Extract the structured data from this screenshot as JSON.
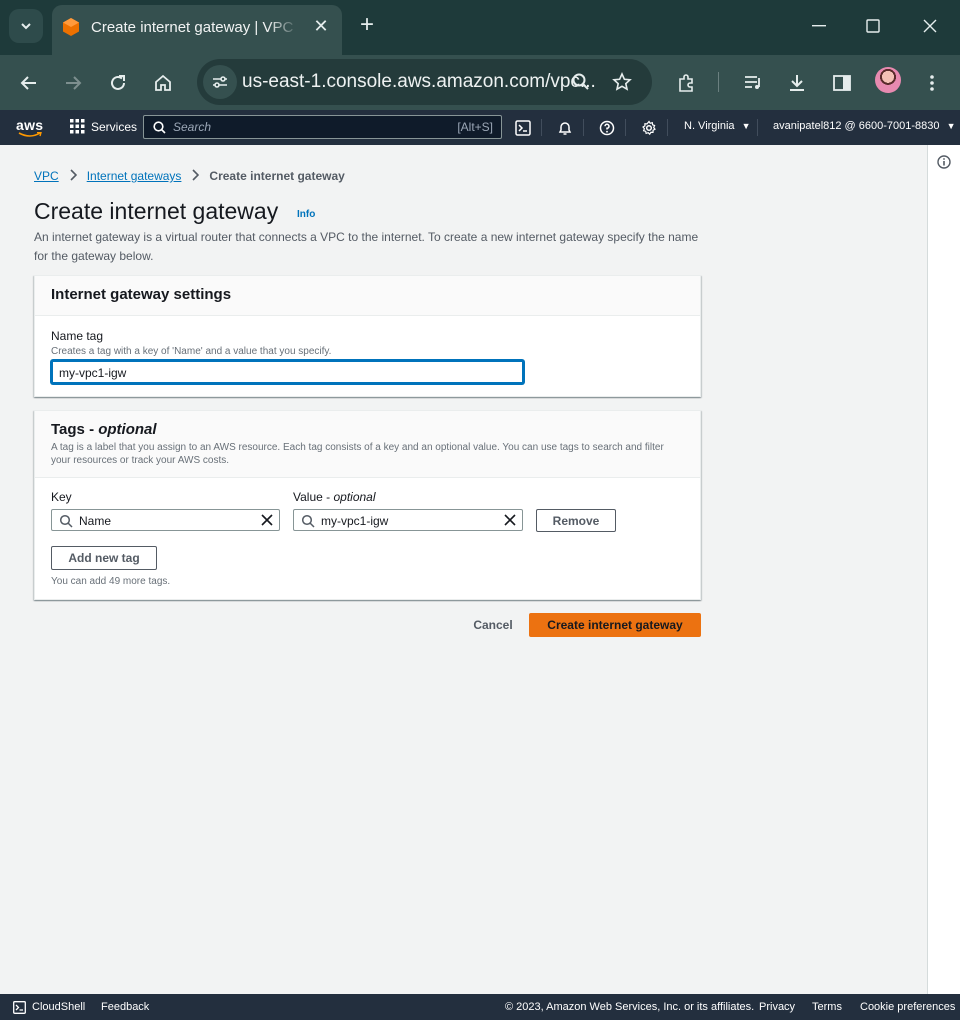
{
  "browser": {
    "tab_title": "Create internet gateway | VPC Management Console",
    "url": "us-east-1.console.aws.amazon.com/vpc..."
  },
  "aws_nav": {
    "logo": "aws",
    "services_label": "Services",
    "search_placeholder": "Search",
    "search_shortcut": "[Alt+S]",
    "region": "N. Virginia",
    "account": "avanipatel812 @ 6600-7001-8830"
  },
  "breadcrumb": {
    "items": [
      "VPC",
      "Internet gateways"
    ],
    "current": "Create internet gateway"
  },
  "page": {
    "title": "Create internet gateway",
    "info_label": "Info",
    "description": "An internet gateway is a virtual router that connects a VPC to the internet. To create a new internet gateway specify the name for the gateway below."
  },
  "settings_panel": {
    "title": "Internet gateway settings",
    "name_tag_label": "Name tag",
    "name_tag_hint": "Creates a tag with a key of 'Name' and a value that you specify.",
    "name_tag_value": "my-vpc1-igw"
  },
  "tags_panel": {
    "title": "Tags - ",
    "title_optional": "optional",
    "description": "A tag is a label that you assign to an AWS resource. Each tag consists of a key and an optional value. You can use tags to search and filter your resources or track your AWS costs.",
    "key_label": "Key",
    "value_label": "Value - ",
    "value_label_optional": "optional",
    "tags": [
      {
        "key": "Name",
        "value": "my-vpc1-igw"
      }
    ],
    "remove_label": "Remove",
    "add_label": "Add new tag",
    "limit_text": "You can add 49 more tags."
  },
  "actions": {
    "cancel_label": "Cancel",
    "create_label": "Create internet gateway"
  },
  "footer": {
    "cloudshell": "CloudShell",
    "feedback": "Feedback",
    "copyright": "© 2023, Amazon Web Services, Inc. or its affiliates.",
    "privacy": "Privacy",
    "terms": "Terms",
    "cookies": "Cookie preferences"
  },
  "colors": {
    "aws_nav": "#232f3e",
    "primary_button": "#ec7211",
    "link": "#0073bb",
    "browser_frame": "#1e3a3a"
  }
}
